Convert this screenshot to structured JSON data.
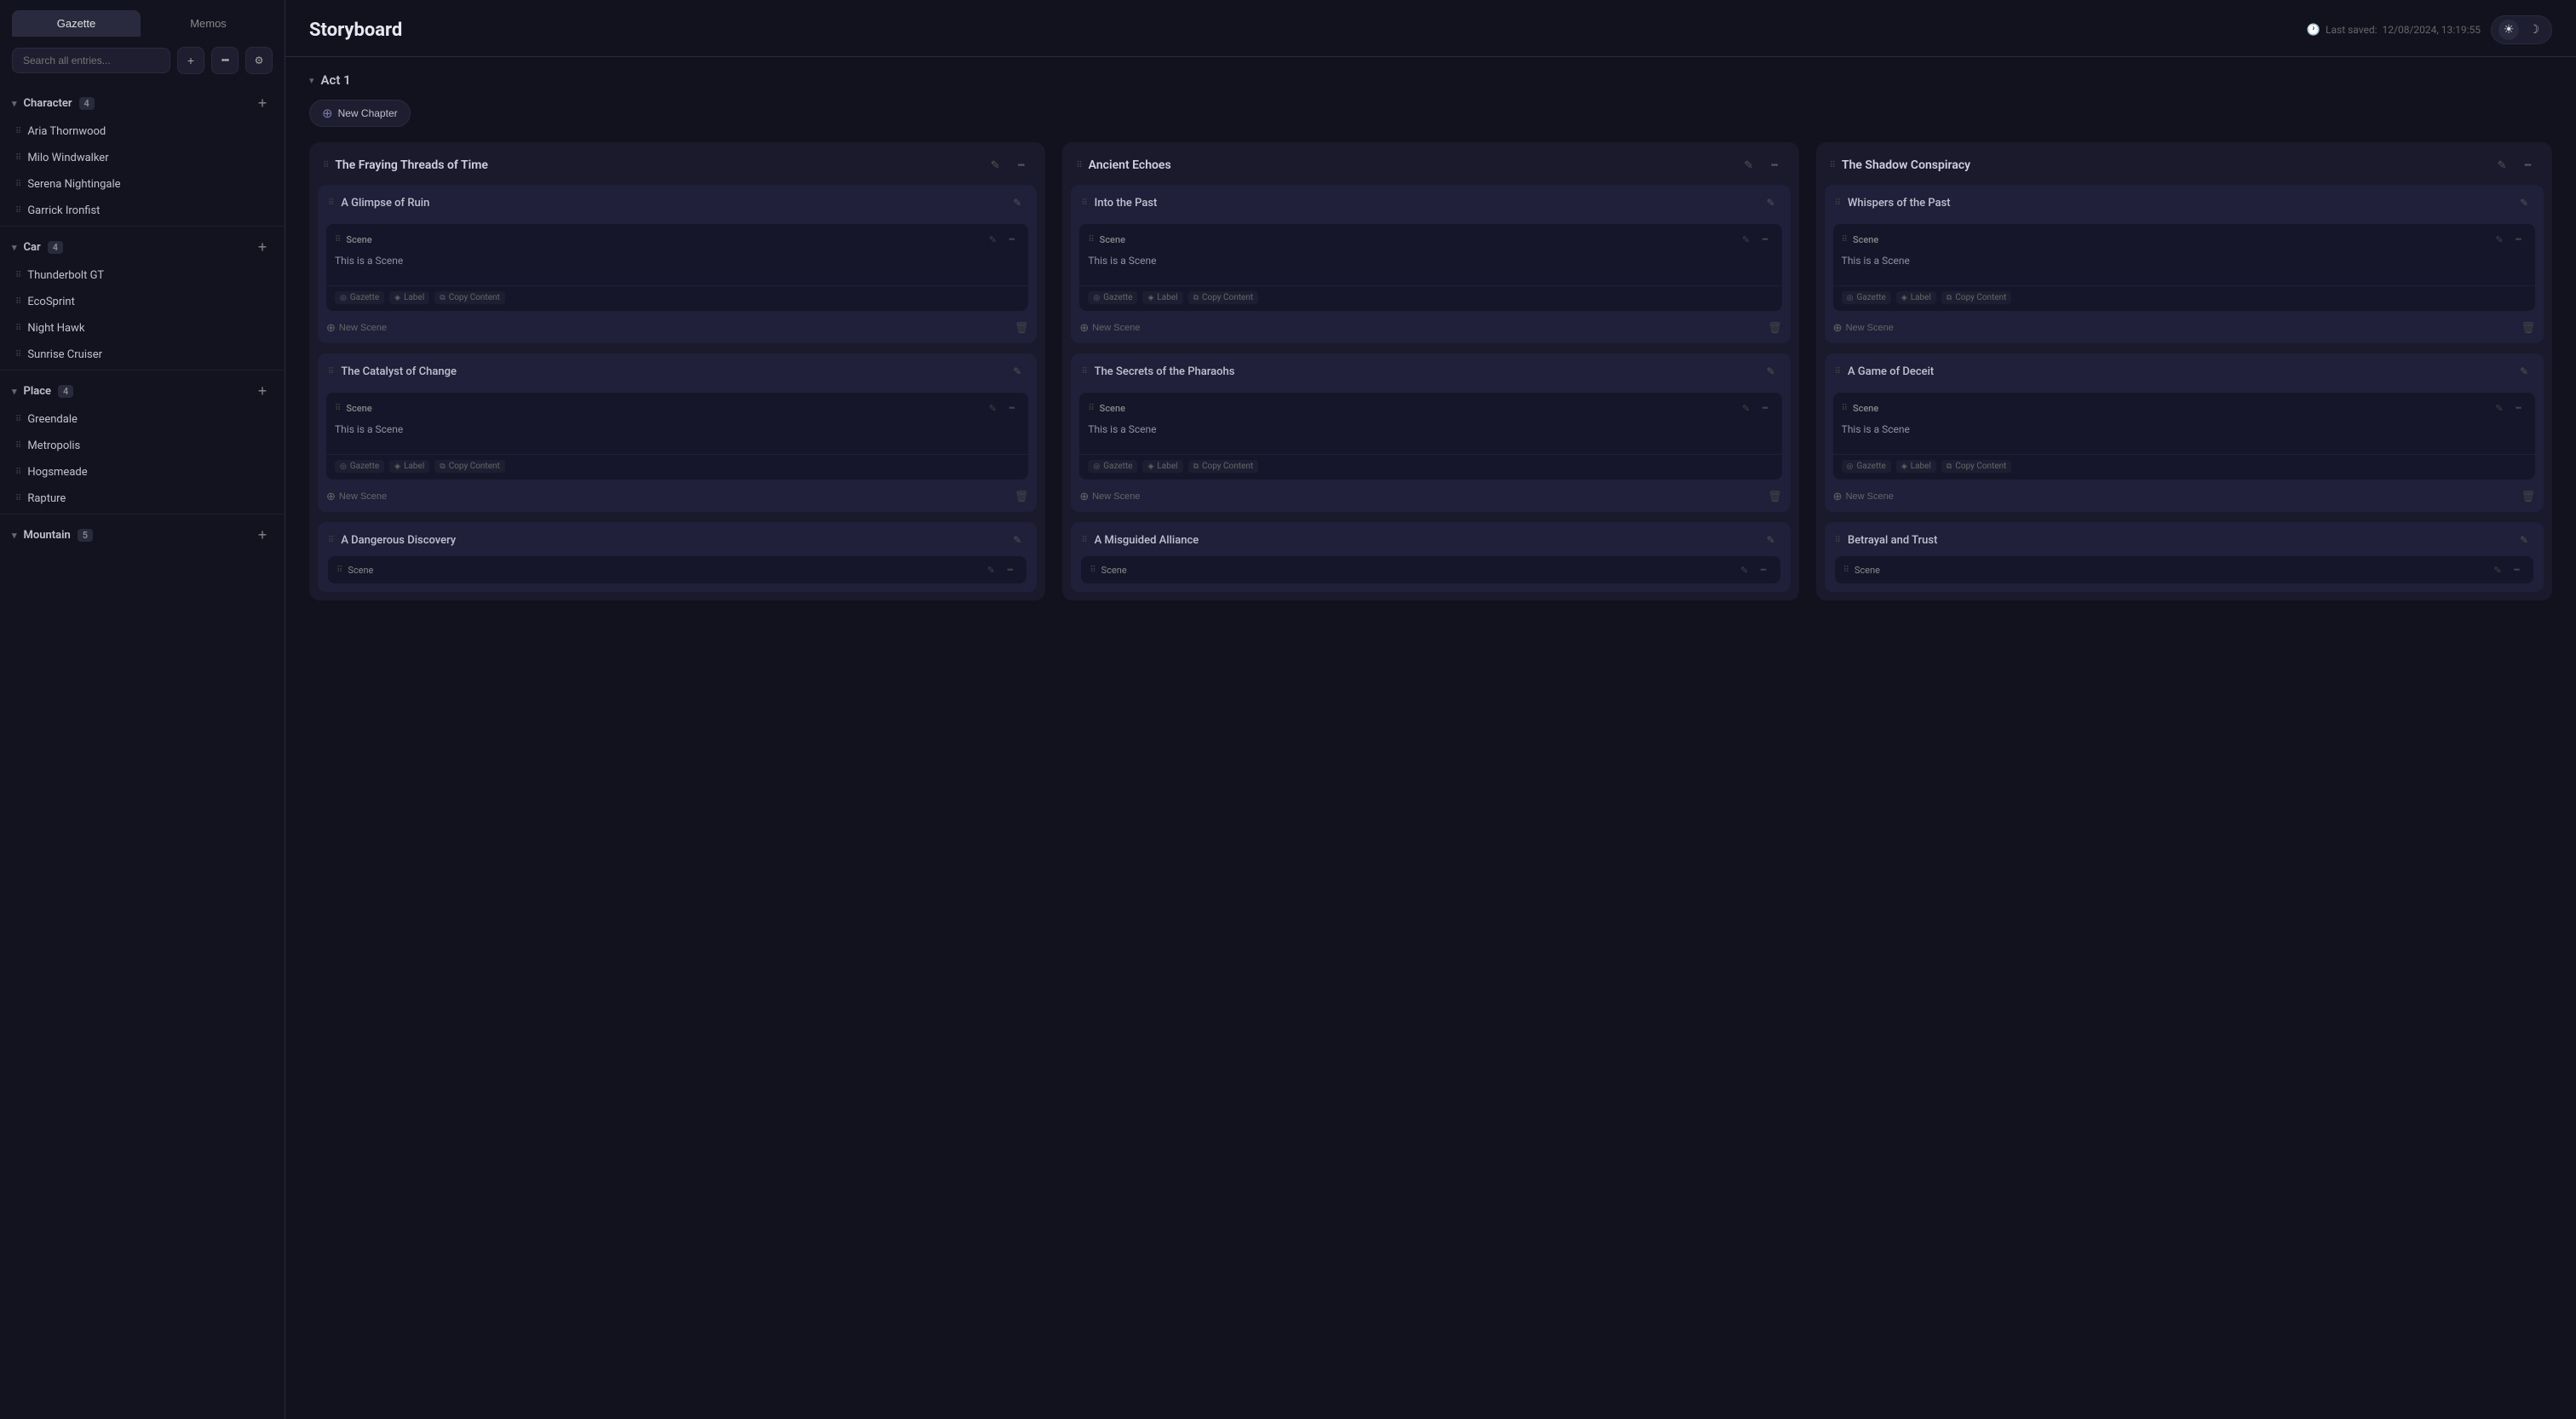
{
  "sidebar": {
    "tabs": [
      {
        "id": "gazette",
        "label": "Gazette",
        "active": true
      },
      {
        "id": "memos",
        "label": "Memos",
        "active": false
      }
    ],
    "search_placeholder": "Search all entries...",
    "sections": [
      {
        "id": "character",
        "title": "Character",
        "count": 4,
        "items": [
          {
            "label": "Aria Thornwood"
          },
          {
            "label": "Milo Windwalker"
          },
          {
            "label": "Serena Nightingale"
          },
          {
            "label": "Garrick Ironfist"
          }
        ]
      },
      {
        "id": "car",
        "title": "Car",
        "count": 4,
        "items": [
          {
            "label": "Thunderbolt GT"
          },
          {
            "label": "EcoSprint"
          },
          {
            "label": "Night Hawk"
          },
          {
            "label": "Sunrise Cruiser"
          }
        ]
      },
      {
        "id": "place",
        "title": "Place",
        "count": 4,
        "items": [
          {
            "label": "Greendale"
          },
          {
            "label": "Metropolis"
          },
          {
            "label": "Hogsmeade"
          },
          {
            "label": "Rapture"
          }
        ]
      },
      {
        "id": "mountain",
        "title": "Mountain",
        "count": 5,
        "items": []
      }
    ]
  },
  "main": {
    "title": "Storyboard",
    "last_saved_label": "Last saved:",
    "last_saved_time": "12/08/2024, 13:19:55",
    "act_label": "Act 1",
    "new_chapter_label": "New Chapter",
    "columns": [
      {
        "id": "col1",
        "title": "The Fraying Threads of Time",
        "chapters": [
          {
            "id": "ch1",
            "title": "A Glimpse of Ruin",
            "scenes": [
              {
                "id": "sc1",
                "label": "Scene",
                "body": "This is a Scene",
                "tags": [
                  "Gazette",
                  "Label",
                  "Copy Content"
                ]
              }
            ]
          },
          {
            "id": "ch2",
            "title": "The Catalyst of Change",
            "scenes": [
              {
                "id": "sc2",
                "label": "Scene",
                "body": "This is a Scene",
                "tags": [
                  "Gazette",
                  "Label",
                  "Copy Content"
                ]
              }
            ]
          },
          {
            "id": "ch3",
            "title": "A Dangerous Discovery",
            "scenes": [
              {
                "id": "sc3",
                "label": "Scene",
                "body": "",
                "tags": []
              }
            ],
            "partial": true
          }
        ]
      },
      {
        "id": "col2",
        "title": "Ancient Echoes",
        "chapters": [
          {
            "id": "ch4",
            "title": "Into the Past",
            "scenes": [
              {
                "id": "sc4",
                "label": "Scene",
                "body": "This is a Scene",
                "tags": [
                  "Gazette",
                  "Label",
                  "Copy Content"
                ]
              }
            ]
          },
          {
            "id": "ch5",
            "title": "The Secrets of the Pharaohs",
            "scenes": [
              {
                "id": "sc5",
                "label": "Scene",
                "body": "This is a Scene",
                "tags": [
                  "Gazette",
                  "Label",
                  "Copy Content"
                ]
              }
            ]
          },
          {
            "id": "ch6",
            "title": "A Misguided Alliance",
            "scenes": [
              {
                "id": "sc6",
                "label": "Scene",
                "body": "",
                "tags": []
              }
            ],
            "partial": true
          }
        ]
      },
      {
        "id": "col3",
        "title": "The Shadow Conspiracy",
        "chapters": [
          {
            "id": "ch7",
            "title": "Whispers of the Past",
            "scenes": [
              {
                "id": "sc7",
                "label": "Scene",
                "body": "This is a Scene",
                "tags": [
                  "Gazette",
                  "Label",
                  "Copy Content"
                ]
              }
            ]
          },
          {
            "id": "ch8",
            "title": "A Game of Deceit",
            "scenes": [
              {
                "id": "sc8",
                "label": "Scene",
                "body": "This is a Scene",
                "tags": [
                  "Gazette",
                  "Label",
                  "Copy Content"
                ]
              }
            ]
          },
          {
            "id": "ch9",
            "title": "Betrayal and Trust",
            "scenes": [
              {
                "id": "sc9",
                "label": "Scene",
                "body": "",
                "tags": []
              }
            ],
            "partial": true
          }
        ]
      }
    ]
  },
  "icons": {
    "chevron_down": "▾",
    "chevron_right": "▸",
    "drag_handle": "⠿",
    "plus": "+",
    "search": "🔍",
    "more": "···",
    "filter": "⚙",
    "edit": "✎",
    "delete": "🗑",
    "copy": "⧉",
    "label_tag": "◈",
    "gazette_icon": "◎",
    "clock": "🕐",
    "sun": "☀",
    "moon": "☽",
    "new_chapter_plus": "⊕"
  }
}
